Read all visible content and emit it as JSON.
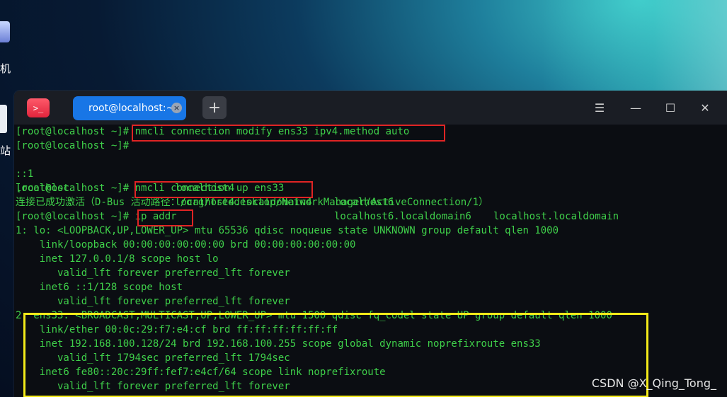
{
  "desktop": {
    "labels": [
      "机",
      "站"
    ]
  },
  "window": {
    "app_icon_glyph": ">_",
    "tab_title": "root@localhost:~",
    "tab_close_glyph": "×",
    "new_tab_glyph": "+",
    "menu_glyph": "☰",
    "minimize_glyph": "—",
    "maximize_glyph": "☐",
    "close_glyph": "✕"
  },
  "terminal": {
    "prompt": "[root@localhost ~]#",
    "cmd1": " nmcli connection modify ens33 ipv4.method auto",
    "cmd2": "",
    "completion_row1": [
      "::1",
      "localhost4",
      "localhost6",
      "localhost.localdomain"
    ],
    "completion_row2": [
      "localhost",
      "localhost4.localdomain4",
      "localhost6.localdomain6",
      ""
    ],
    "cmd3": " nmcli connection up ens33",
    "activation_msg": "连接已成功激活（D-Bus 活动路径：/org/freedesktop/NetworkManager/ActiveConnection/1）",
    "cmd4": " ip addr",
    "out": [
      "1: lo: <LOOPBACK,UP,LOWER_UP> mtu 65536 qdisc noqueue state UNKNOWN group default qlen 1000",
      "    link/loopback 00:00:00:00:00:00 brd 00:00:00:00:00:00",
      "    inet 127.0.0.1/8 scope host lo",
      "       valid_lft forever preferred_lft forever",
      "    inet6 ::1/128 scope host",
      "       valid_lft forever preferred_lft forever",
      "2: ens33: <BROADCAST,MULTICAST,UP,LOWER_UP> mtu 1500 qdisc fq_codel state UP group default qlen 1000",
      "    link/ether 00:0c:29:f7:e4:cf brd ff:ff:ff:ff:ff:ff",
      "    inet 192.168.100.128/24 brd 192.168.100.255 scope global dynamic noprefixroute ens33",
      "       valid_lft 1794sec preferred_lft 1794sec",
      "    inet6 fe80::20c:29ff:fef7:e4cf/64 scope link noprefixroute",
      "       valid_lft forever preferred_lft forever"
    ]
  },
  "watermark": "CSDN @X_Qing_Tong_",
  "colors": {
    "terminal_text": "#3fd04a",
    "highlight_red": "#e02424",
    "highlight_yellow": "#f3ea19",
    "tab_active": "#1876e6"
  }
}
